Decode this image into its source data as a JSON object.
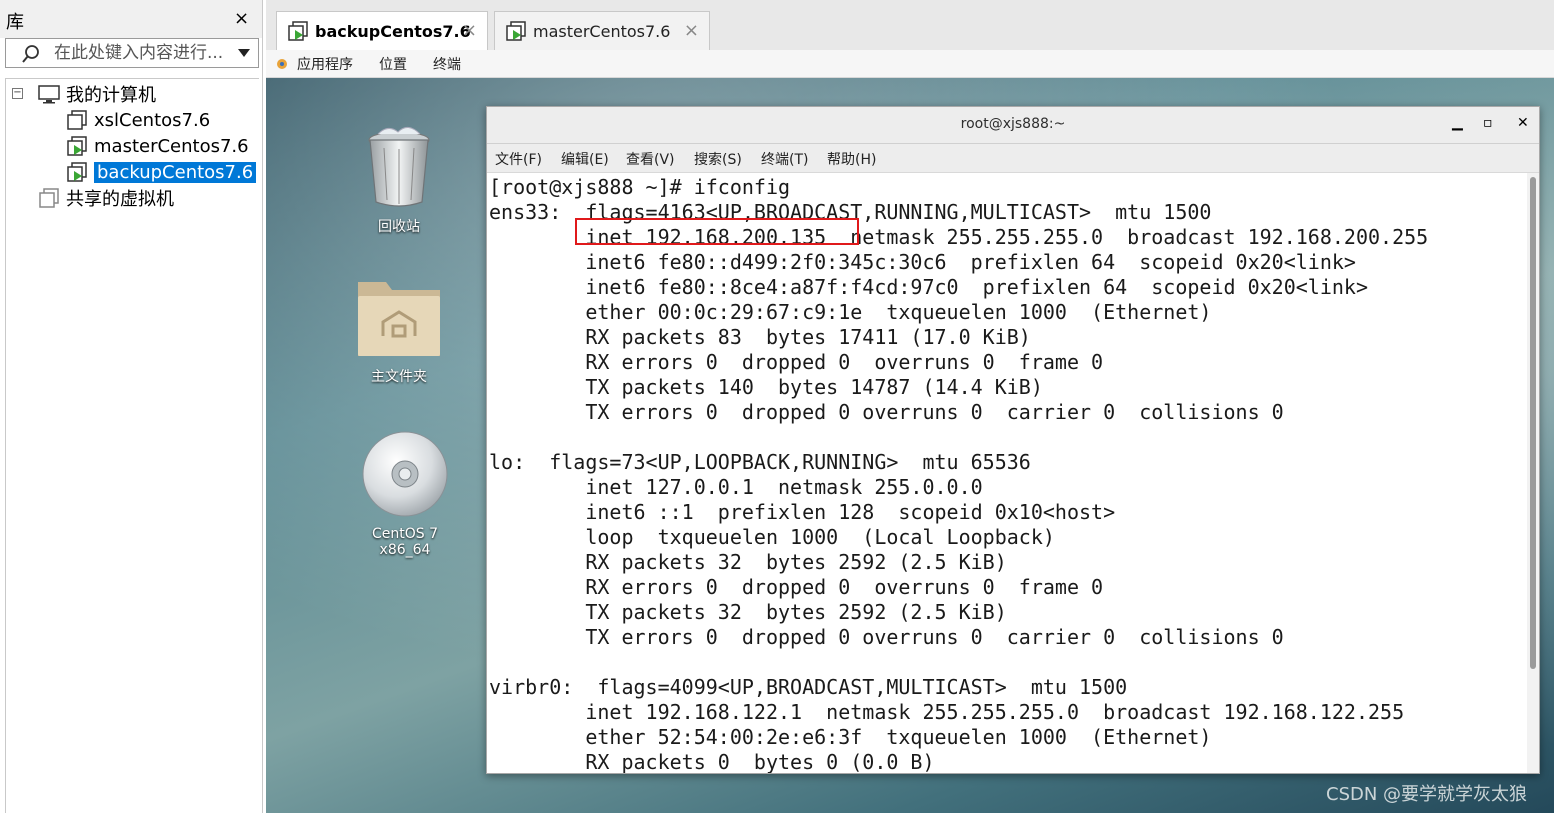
{
  "library": {
    "title": "库",
    "close": "×",
    "search_placeholder": "在此处键入内容进行...",
    "tree": {
      "root": "我的计算机",
      "vms": [
        "xslCentos7.6",
        "masterCentos7.6",
        "backupCentos7.6"
      ],
      "selected": "backupCentos7.6",
      "shared": "共享的虚拟机"
    }
  },
  "tabs": [
    {
      "label": "backupCentos7.6",
      "active": true,
      "close": "×"
    },
    {
      "label": "masterCentos7.6",
      "active": false,
      "close": "×"
    }
  ],
  "gnome_menu": {
    "applications": "应用程序",
    "places": "位置",
    "terminal": "终端"
  },
  "desktop": {
    "icons": [
      {
        "label": "回收站",
        "icon": "trash-icon"
      },
      {
        "label": "主文件夹",
        "icon": "home-folder-icon"
      },
      {
        "label": "CentOS 7 x86_64",
        "icon": "cd-disc-icon"
      }
    ]
  },
  "terminal": {
    "title": "root@xjs888:~",
    "buttons": {
      "minimize": "▁",
      "maximize": "▫",
      "close": "✕"
    },
    "menu": [
      "文件(F)",
      "编辑(E)",
      "查看(V)",
      "搜索(S)",
      "终端(T)",
      "帮助(H)"
    ],
    "lines": [
      "[root@xjs888 ~]# ifconfig",
      "ens33:  flags=4163<UP,BROADCAST,RUNNING,MULTICAST>  mtu 1500",
      "        inet 192.168.200.135  netmask 255.255.255.0  broadcast 192.168.200.255",
      "        inet6 fe80::d499:2f0:345c:30c6  prefixlen 64  scopeid 0x20<link>",
      "        inet6 fe80::8ce4:a87f:f4cd:97c0  prefixlen 64  scopeid 0x20<link>",
      "        ether 00:0c:29:67:c9:1e  txqueuelen 1000  (Ethernet)",
      "        RX packets 83  bytes 17411 (17.0 KiB)",
      "        RX errors 0  dropped 0  overruns 0  frame 0",
      "        TX packets 140  bytes 14787 (14.4 KiB)",
      "        TX errors 0  dropped 0 overruns 0  carrier 0  collisions 0",
      "",
      "lo:  flags=73<UP,LOOPBACK,RUNNING>  mtu 65536",
      "        inet 127.0.0.1  netmask 255.0.0.0",
      "        inet6 ::1  prefixlen 128  scopeid 0x10<host>",
      "        loop  txqueuelen 1000  (Local Loopback)",
      "        RX packets 32  bytes 2592 (2.5 KiB)",
      "        RX errors 0  dropped 0  overruns 0  frame 0",
      "        TX packets 32  bytes 2592 (2.5 KiB)",
      "        TX errors 0  dropped 0 overruns 0  carrier 0  collisions 0",
      "",
      "virbr0:  flags=4099<UP,BROADCAST,MULTICAST>  mtu 1500",
      "        inet 192.168.122.1  netmask 255.255.255.0  broadcast 192.168.122.255",
      "        ether 52:54:00:2e:e6:3f  txqueuelen 1000  (Ethernet)",
      "        RX packets 0  bytes 0 (0.0 B)"
    ],
    "highlight_color": "#e0191b"
  },
  "watermark": "CSDN @要学就学灰太狼",
  "colors": {
    "selection": "#0078d7",
    "vm_icon_green": "#3aa635"
  }
}
